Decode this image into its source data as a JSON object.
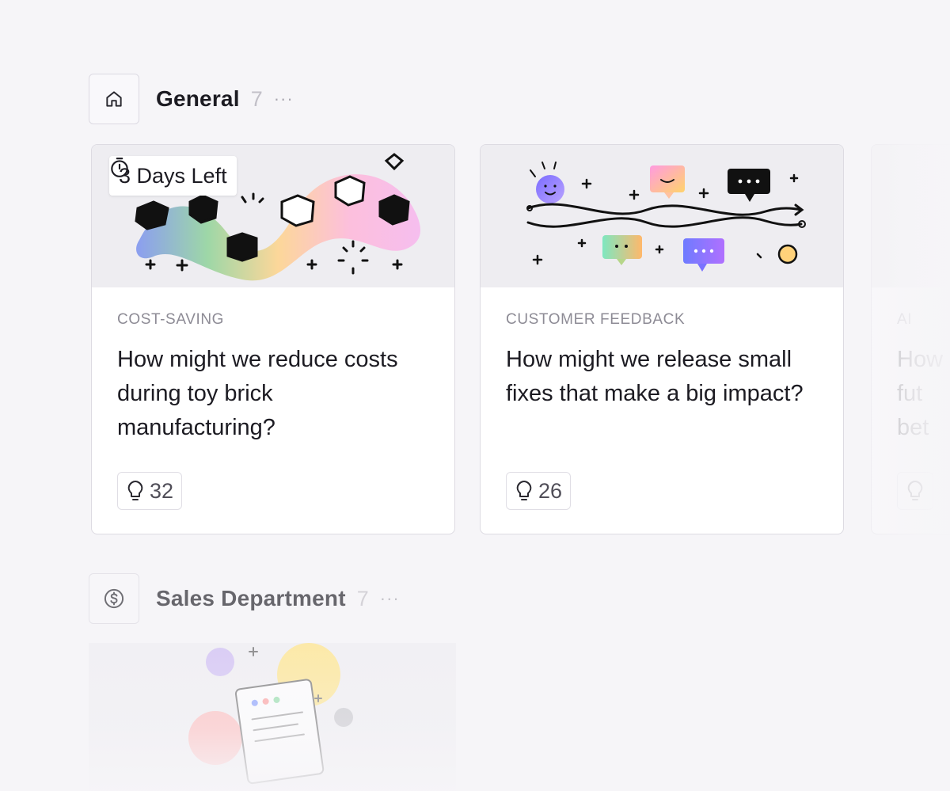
{
  "sections": {
    "general": {
      "title": "General",
      "count": "7",
      "more": "···",
      "icon": "home-icon"
    },
    "sales": {
      "title": "Sales Department",
      "count": "7",
      "more": "···",
      "icon": "dollar-coin-icon"
    }
  },
  "cards": [
    {
      "deadline": "3 Days Left",
      "category": "COST-SAVING",
      "question": "How might we reduce costs during toy brick manufacturing?",
      "ideas": "32"
    },
    {
      "category": "CUSTOMER FEEDBACK",
      "question": "How might we release small fixes that make a big impact?",
      "ideas": "26"
    },
    {
      "category": "AI",
      "question": "How fut bet"
    }
  ],
  "colors": {
    "background": "#f6f5f8",
    "card": "#ffffff",
    "art_background": "#eeedf1",
    "category_text": "#8d8b95"
  }
}
